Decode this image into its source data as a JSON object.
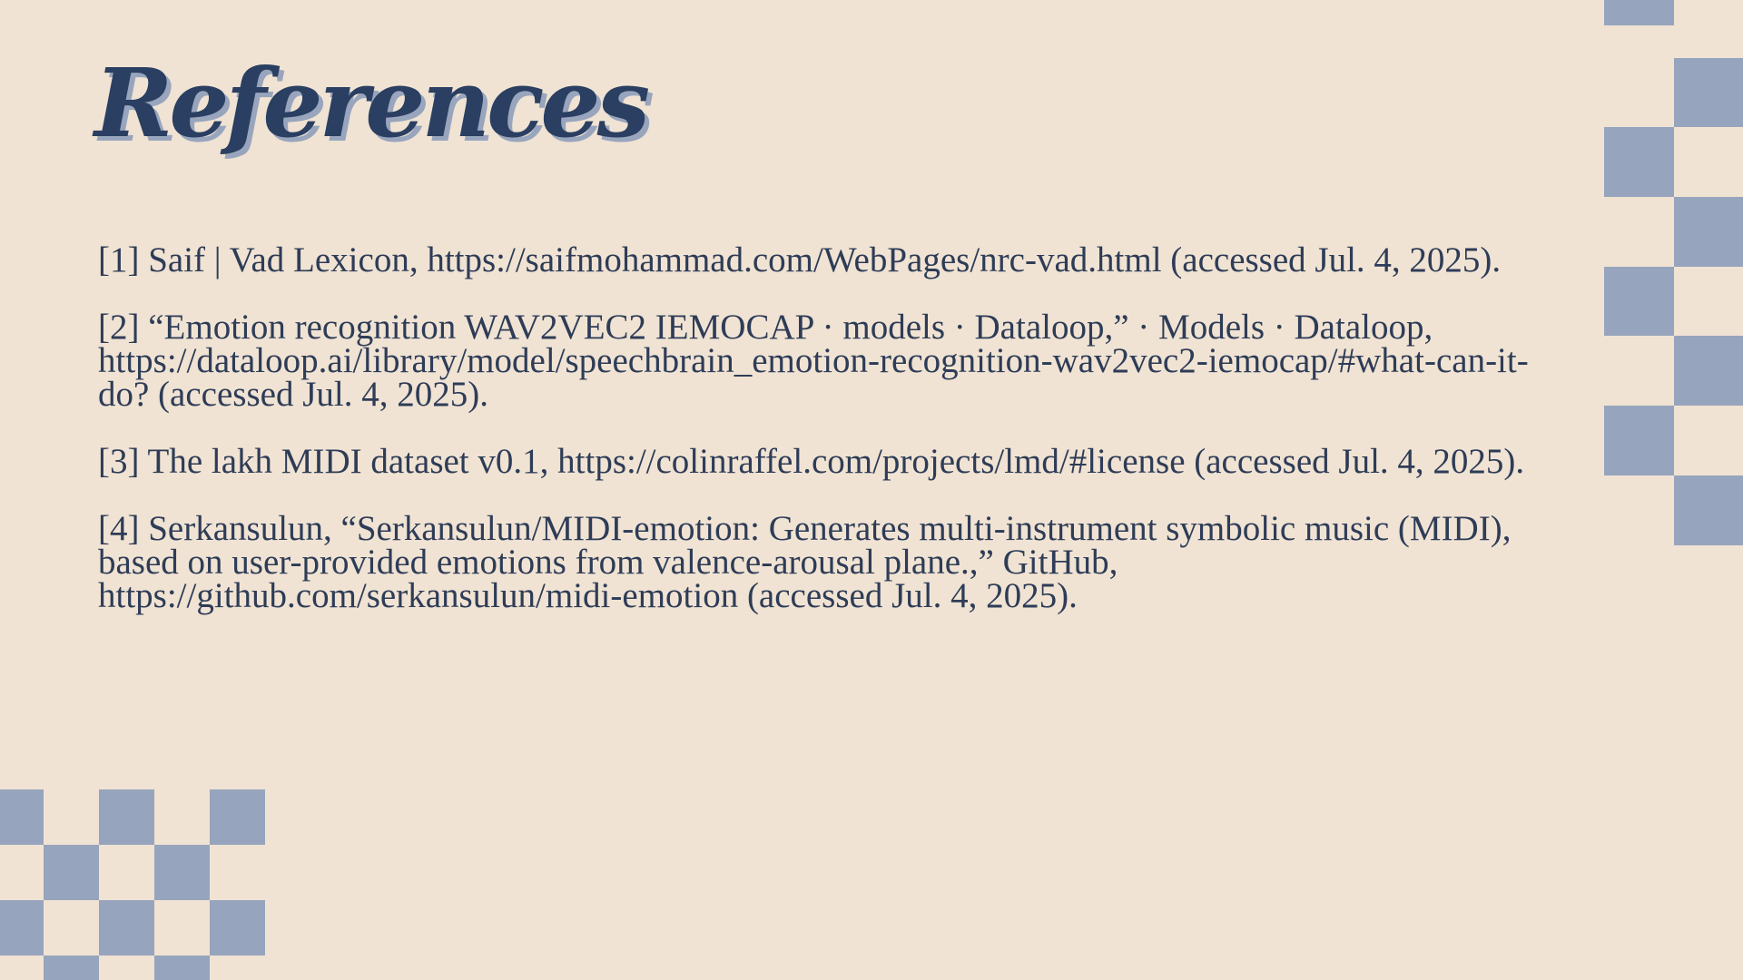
{
  "slide": {
    "title": "References",
    "references": [
      "[1] Saif | Vad Lexicon, https://saifmohammad.com/WebPages/nrc-vad.html (accessed Jul. 4, 2025).",
      "[2] “Emotion recognition WAV2VEC2 IEMOCAP · models · Dataloop,” · Models · Dataloop, https://dataloop.ai/library/model/speechbrain_emotion-recognition-wav2vec2-iemocap/#what-can-it-do? (accessed Jul. 4, 2025).",
      "[3] The lakh MIDI dataset v0.1, https://colinraffel.com/projects/lmd/#license (accessed Jul. 4, 2025).",
      "[4] Serkansulun, “Serkansulun/MIDI-emotion: Generates multi-instrument symbolic music (MIDI), based on user-provided emotions from valence-arousal plane.,” GitHub, https://github.com/serkansulun/midi-emotion (accessed Jul. 4, 2025)."
    ]
  },
  "colors": {
    "background": "#f0e3d3",
    "title": "#2a3f61",
    "title_shadow": "#98a5bd",
    "text": "#2e3c57",
    "checker": "#97a4bd"
  }
}
